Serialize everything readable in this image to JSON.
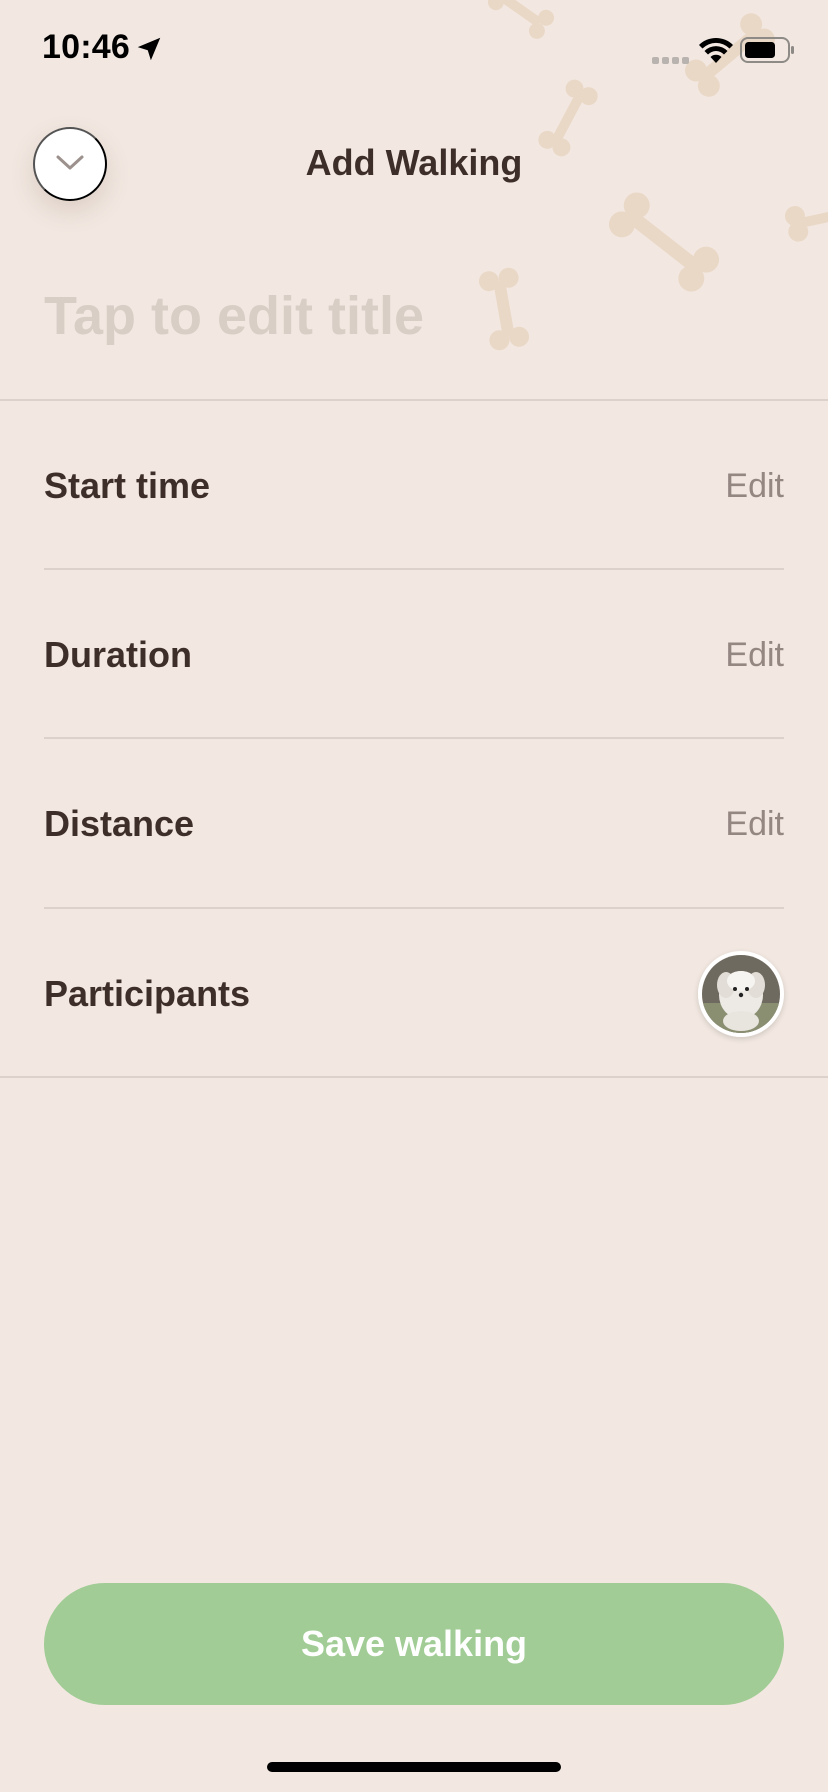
{
  "status_bar": {
    "time": "10:46",
    "icons": [
      "location-arrow-icon",
      "signal-icon",
      "wifi-icon",
      "battery-icon"
    ]
  },
  "header": {
    "collapse_icon": "chevron-down-icon",
    "title": "Add Walking"
  },
  "title_field": {
    "placeholder": "Tap to edit title",
    "value": ""
  },
  "rows": [
    {
      "label": "Start time",
      "action": "Edit"
    },
    {
      "label": "Duration",
      "action": "Edit"
    },
    {
      "label": "Distance",
      "action": "Edit"
    },
    {
      "label": "Participants"
    }
  ],
  "save_button": {
    "label": "Save walking"
  },
  "colors": {
    "background": "#F2E8E1",
    "text_dark": "#3E2E29",
    "text_muted": "#948681",
    "placeholder": "#D9CEC6",
    "accent_green": "#A1CC95",
    "bone": "#EAD8C7"
  }
}
